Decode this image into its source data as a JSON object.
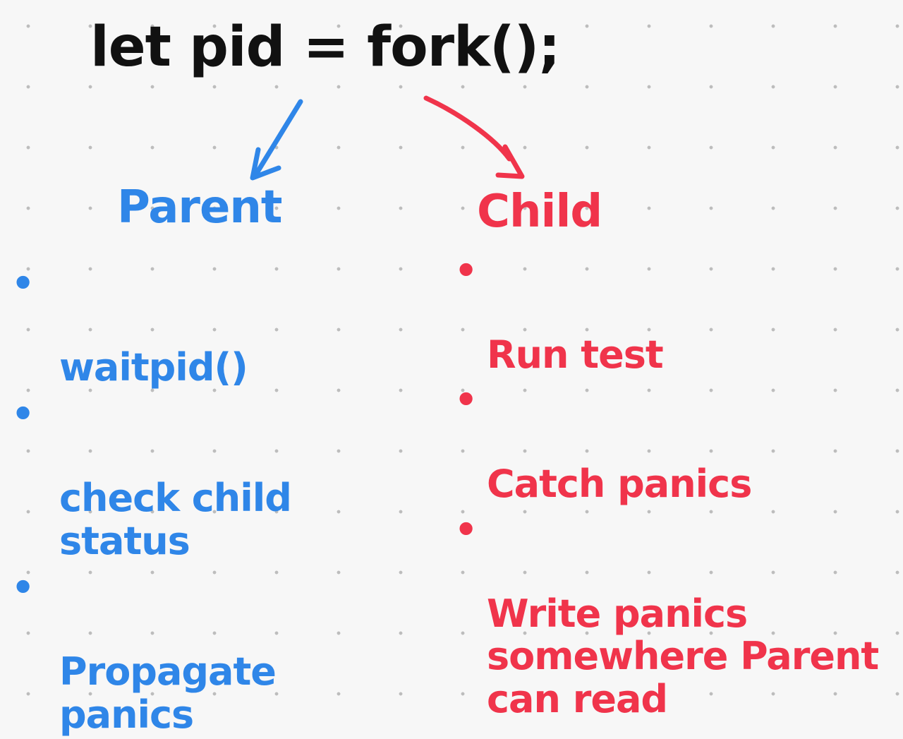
{
  "code": {
    "text": "let pid = fork();"
  },
  "parent": {
    "heading": "Parent",
    "bullet": "•",
    "items": [
      "waitpid()",
      "check child\nstatus",
      "Propagate\npanics"
    ]
  },
  "child": {
    "heading": "Child",
    "bullet": "•",
    "items": [
      "Run test",
      "Catch panics",
      "Write panics\nsomewhere Parent\ncan read"
    ]
  },
  "colors": {
    "code": "#111111",
    "parent": "#2f86e8",
    "child": "#f0344b",
    "background": "#f7f7f7",
    "grid_dot": "#bdbdbd"
  }
}
